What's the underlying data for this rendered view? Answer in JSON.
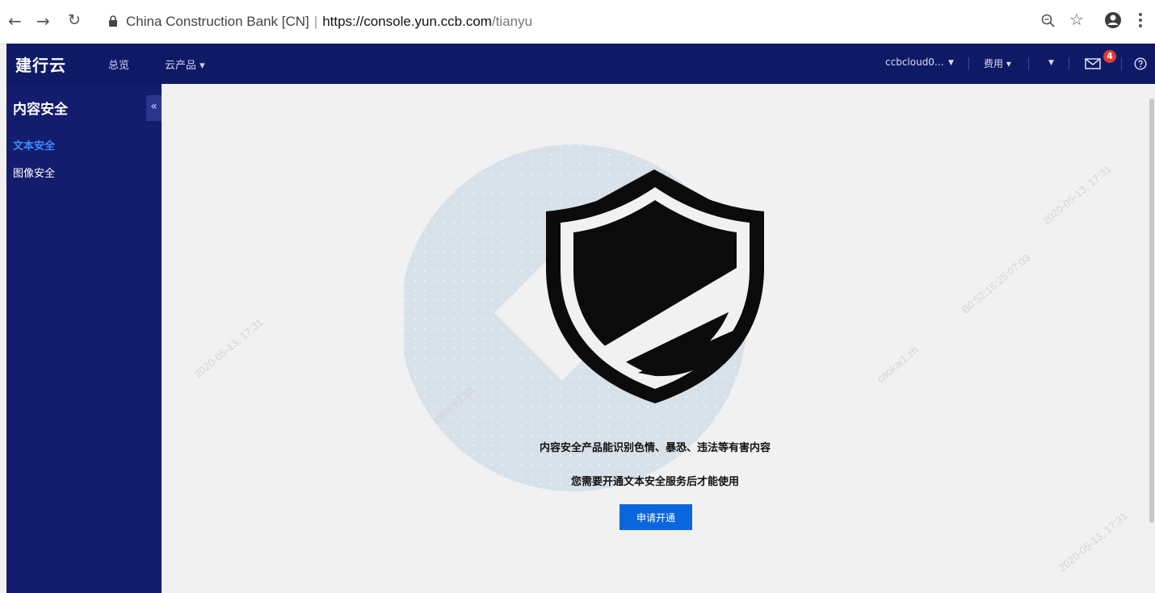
{
  "browser": {
    "site_identity": "China Construction Bank [CN]",
    "url_host": "https://console.yun.ccb.com",
    "url_path": "/tianyu"
  },
  "header": {
    "brand": "建行云",
    "nav": [
      "总览",
      "云产品 ▾"
    ],
    "account": "ccbcloud0...",
    "fees": "费用 ▾",
    "notification_count": "4"
  },
  "sidebar": {
    "title": "内容安全",
    "collapse_glyph": "«",
    "items": [
      {
        "label": "文本安全",
        "active": true
      },
      {
        "label": "图像安全",
        "active": false
      }
    ]
  },
  "main": {
    "description": "内容安全产品能识别色情、暴恐、违法等有害内容",
    "notice": "您需要开通文本安全服务后才能使用",
    "apply_button": "申请开通"
  },
  "watermark": {
    "user": "caokai1.zh",
    "mac": "B0:52:16:25:07:03",
    "time": "2020-05-13, 17:31"
  },
  "colors": {
    "header_bg": "#0f1a66",
    "sidebar_bg": "#141c6e",
    "active_item": "#3c8dff",
    "button": "#0a66dc",
    "badge": "#e53935"
  }
}
